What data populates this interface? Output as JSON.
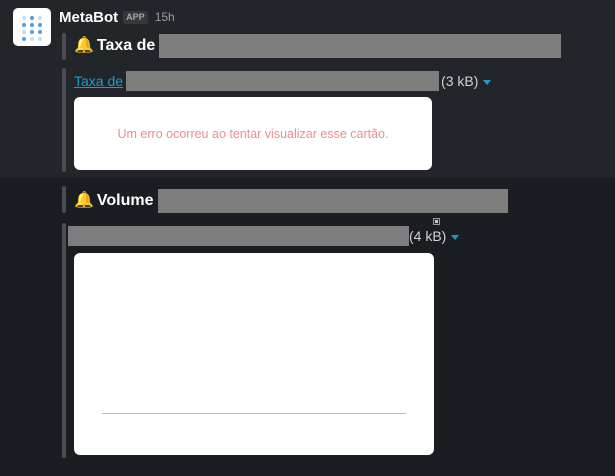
{
  "message": {
    "bot_name": "MetaBot",
    "app_badge": "APP",
    "time": "15h"
  },
  "alert1": {
    "bell_icon": "🔔",
    "title_prefix": "Taxa de",
    "file_link": "Taxa de",
    "file_size": "(3 kB)",
    "error_text": "Um erro ocorreu ao tentar visualizar esse cartão."
  },
  "alert2": {
    "bell_icon": "🔔",
    "title_prefix": "Volume",
    "file_size": "(4 kB)"
  },
  "colors": {
    "link": "#1d9bd1",
    "error": "#ef8c8c",
    "redaction": "#7d7d7d"
  }
}
